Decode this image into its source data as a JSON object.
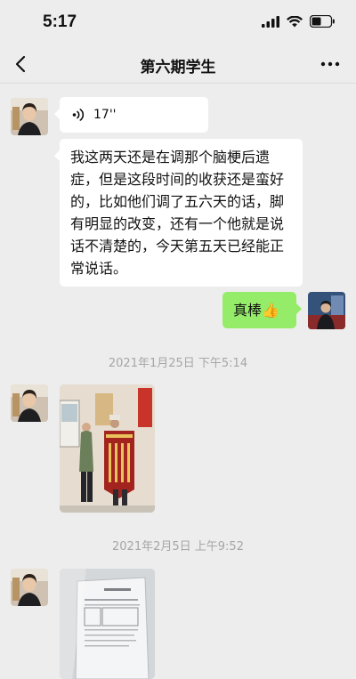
{
  "status": {
    "time": "5:17",
    "icons": [
      "cellular-signal-icon",
      "wifi-icon",
      "battery-icon"
    ]
  },
  "nav": {
    "title": "第六期学生",
    "icons": [
      "back-arrow-icon",
      "more-icon"
    ]
  },
  "messages": {
    "voice_duration": "17''",
    "text_long": "我这两天还是在调那个脑梗后遗症，但是这段时间的收获还是蛮好的，比如他们调了五六天的话，脚有明显的改变，还有一个他就是说话不清楚的，今天第五天已经能正常说话。",
    "reply_text": "真棒👍",
    "time_1": "2021年1月25日 下午5:14",
    "time_2": "2021年2月5日 上午9:52"
  },
  "colors": {
    "background": "#ededed",
    "bubble_in": "#ffffff",
    "bubble_out": "#95ec69",
    "timestamp": "#a6a6a6"
  }
}
